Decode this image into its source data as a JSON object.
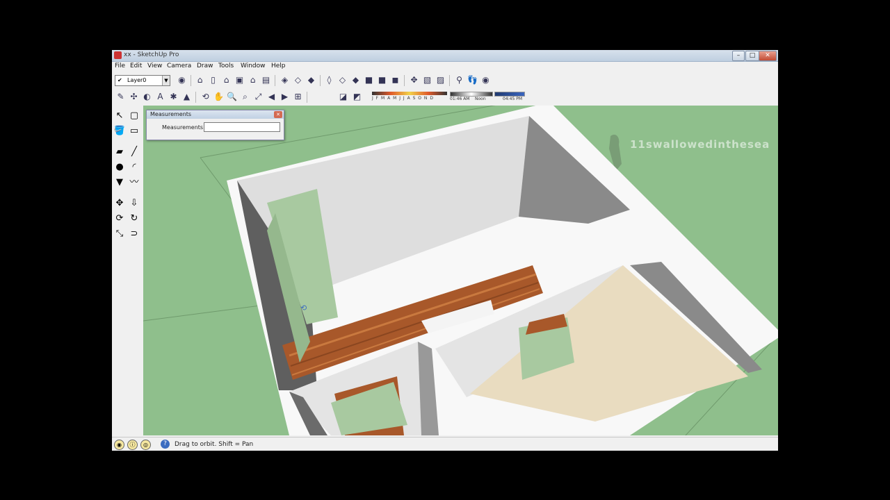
{
  "window": {
    "title": "xx - SketchUp Pro",
    "controls": {
      "minimize": "–",
      "maximize": "□",
      "close": "✕"
    }
  },
  "menu": [
    "File",
    "Edit",
    "View",
    "Camera",
    "Draw",
    "Tools",
    "Window",
    "Help"
  ],
  "layer": {
    "current": "Layer0"
  },
  "shadow": {
    "months": "J F M A M J J A S O N D",
    "date": "01:46 AM",
    "noon_label": "Noon",
    "time": "04:45 PM"
  },
  "watermark": "11swallowedinthesea",
  "measurements_panel": {
    "title": "Measurements",
    "label": "Measurements",
    "value": ""
  },
  "status": {
    "text": "Drag to orbit.  Shift = Pan"
  },
  "icons": {
    "toolbar_top": [
      "select-icon",
      "components-icon",
      "paint-icon",
      "eraser-icon",
      "rectangle-icon",
      "line-icon",
      "circle-icon",
      "arc-icon",
      "polygon-icon",
      "freehand-icon",
      "move-icon",
      "push-pull-icon",
      "rotate-icon",
      "follow-me-icon",
      "scale-icon",
      "offset-icon"
    ],
    "views": [
      "iso-view-icon",
      "top-view-icon",
      "front-view-icon",
      "right-view-icon",
      "back-view-icon",
      "left-view-icon"
    ],
    "styles": [
      "xray-icon",
      "wireframe-icon",
      "hidden-line-icon",
      "shaded-icon",
      "shaded-texture-icon",
      "monochrome-icon"
    ],
    "navigation": [
      "orbit-icon",
      "pan-icon",
      "zoom-icon",
      "zoom-window-icon",
      "zoom-extents-icon",
      "previous-view-icon",
      "next-view-icon",
      "position-camera-icon",
      "walk-icon",
      "look-around-icon"
    ]
  },
  "colors": {
    "ground": "#8fbf8c",
    "wall_top": "#ffffff",
    "wall_inner": "#dcdcdc",
    "wall_shadow": "#7e7e7e",
    "wood_floor": "#a8582a",
    "tile_floor": "#e9dcc0",
    "door": "#a8c9a0"
  }
}
